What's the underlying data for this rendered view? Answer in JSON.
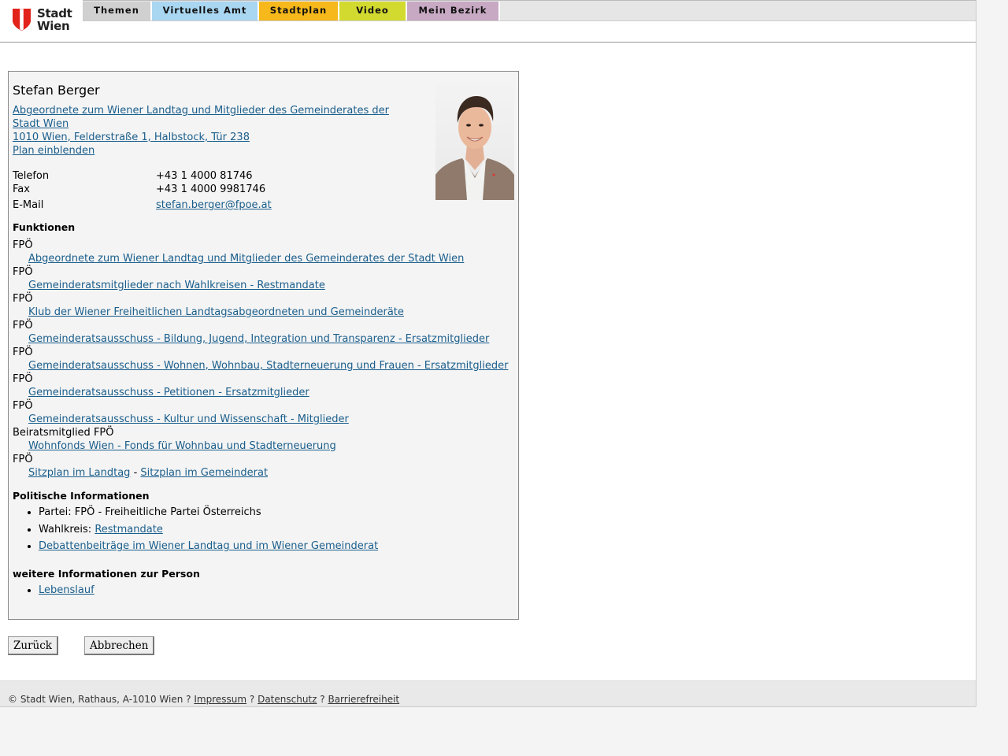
{
  "header": {
    "logo_line1": "Stadt",
    "logo_line2": "Wien",
    "tabs": [
      {
        "label": "Themen",
        "color": "#d0d0d0"
      },
      {
        "label": "Virtuelles Amt",
        "color": "#a9d6f1"
      },
      {
        "label": "Stadtplan",
        "color": "#f6b81a"
      },
      {
        "label": "Video",
        "color": "#d3da2f"
      },
      {
        "label": "Mein Bezirk",
        "color": "#c7a9c3"
      }
    ]
  },
  "person": {
    "name": "Stefan Berger",
    "role_line1": "Abgeordnete zum Wiener Landtag und Mitglieder des Gemeinderates der",
    "role_line2": "Stadt Wien",
    "address": "1010 Wien, Felderstraße 1, Halbstock, Tür 238",
    "plan_link": "Plan einblenden",
    "contact": [
      {
        "label": "Telefon",
        "value": "+43 1 4000 81746"
      },
      {
        "label": "Fax",
        "value": "+43 1 4000 9981746"
      },
      {
        "label": "E-Mail",
        "value": "stefan.berger@fpoe.at"
      }
    ]
  },
  "funktionen": {
    "heading": "Funktionen",
    "items": [
      {
        "party": "FPÖ",
        "link": "Abgeordnete zum Wiener Landtag und Mitglieder des Gemeinderates der Stadt Wien"
      },
      {
        "party": "FPÖ",
        "link": "Gemeinderatsmitglieder nach Wahlkreisen - Restmandate"
      },
      {
        "party": "FPÖ",
        "link": "Klub der Wiener Freiheitlichen Landtagsabgeordneten und Gemeinderäte"
      },
      {
        "party": "FPÖ",
        "link": "Gemeinderatsausschuss - Bildung, Jugend, Integration und Transparenz - Ersatzmitglieder"
      },
      {
        "party": "FPÖ",
        "link": "Gemeinderatsausschuss - Wohnen, Wohnbau, Stadterneuerung und Frauen - Ersatzmitglieder"
      },
      {
        "party": "FPÖ",
        "link": "Gemeinderatsausschuss - Petitionen - Ersatzmitglieder"
      },
      {
        "party": "FPÖ",
        "link": "Gemeinderatsausschuss - Kultur und Wissenschaft - Mitglieder"
      },
      {
        "party": "Beiratsmitglied FPÖ",
        "link": "Wohnfonds Wien - Fonds für Wohnbau und Stadterneuerung"
      }
    ],
    "last_party": "FPÖ",
    "sitzplan_landtag": "Sitzplan im Landtag",
    "separator": "-",
    "sitzplan_gemeinderat": "Sitzplan im Gemeinderat"
  },
  "politisch": {
    "heading": "Politische Informationen",
    "partei_prefix": "Partei: ",
    "partei_value": "FPÖ - Freiheitliche Partei Österreichs",
    "wahlkreis_prefix": "Wahlkreis: ",
    "wahlkreis_link": "Restmandate",
    "debatten_link": "Debattenbeiträge im Wiener Landtag und im Wiener Gemeinderat"
  },
  "weitere": {
    "heading": "weitere Informationen zur Person",
    "lebenslauf": "Lebenslauf"
  },
  "buttons": {
    "back": "Zurück",
    "cancel": "Abbrechen"
  },
  "footer": {
    "copyright": "© Stadt Wien, Rathaus, A-1010 Wien",
    "sep": "?",
    "impressum": "Impressum",
    "datenschutz": "Datenschutz",
    "barrierefreiheit": "Barrierefreiheit"
  }
}
